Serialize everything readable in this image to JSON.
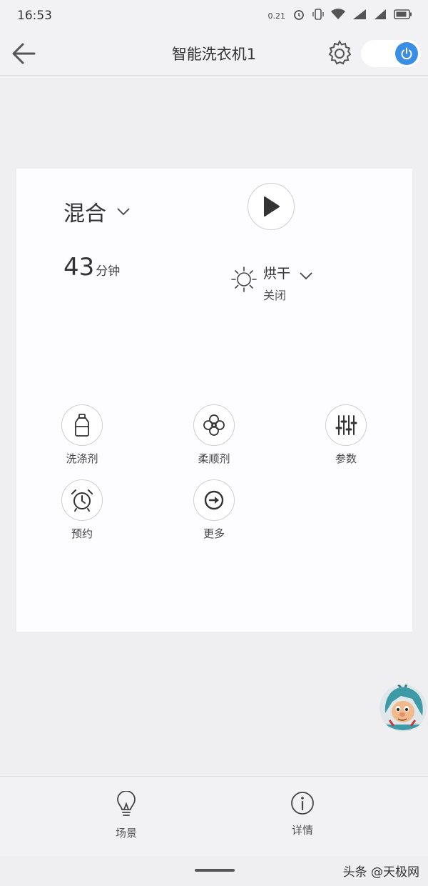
{
  "status_bar": {
    "time": "16:53",
    "icons": [
      "data-speed-icon",
      "alarm-icon",
      "vibrate-icon",
      "wifi-icon",
      "signal-icon",
      "signal-icon-2",
      "battery-icon"
    ],
    "data_speed": "0.21"
  },
  "header": {
    "title": "智能洗衣机1",
    "power_on": true,
    "accent_color": "#3a8ee6"
  },
  "control_card": {
    "mode": "混合",
    "time_value": "43",
    "time_unit": "分钟",
    "dry_label": "烘干",
    "dry_status": "关闭"
  },
  "functions": [
    {
      "label": "洗涤剂",
      "icon": "detergent-bottle-icon"
    },
    {
      "label": "柔顺剂",
      "icon": "softener-flower-icon"
    },
    {
      "label": "参数",
      "icon": "sliders-icon"
    },
    {
      "label": "预约",
      "icon": "alarm-clock-icon"
    },
    {
      "label": "更多",
      "icon": "arrow-right-circle-icon"
    }
  ],
  "bottom_nav": {
    "scene": "场景",
    "details": "详情"
  },
  "watermark": "头条 @天极网"
}
